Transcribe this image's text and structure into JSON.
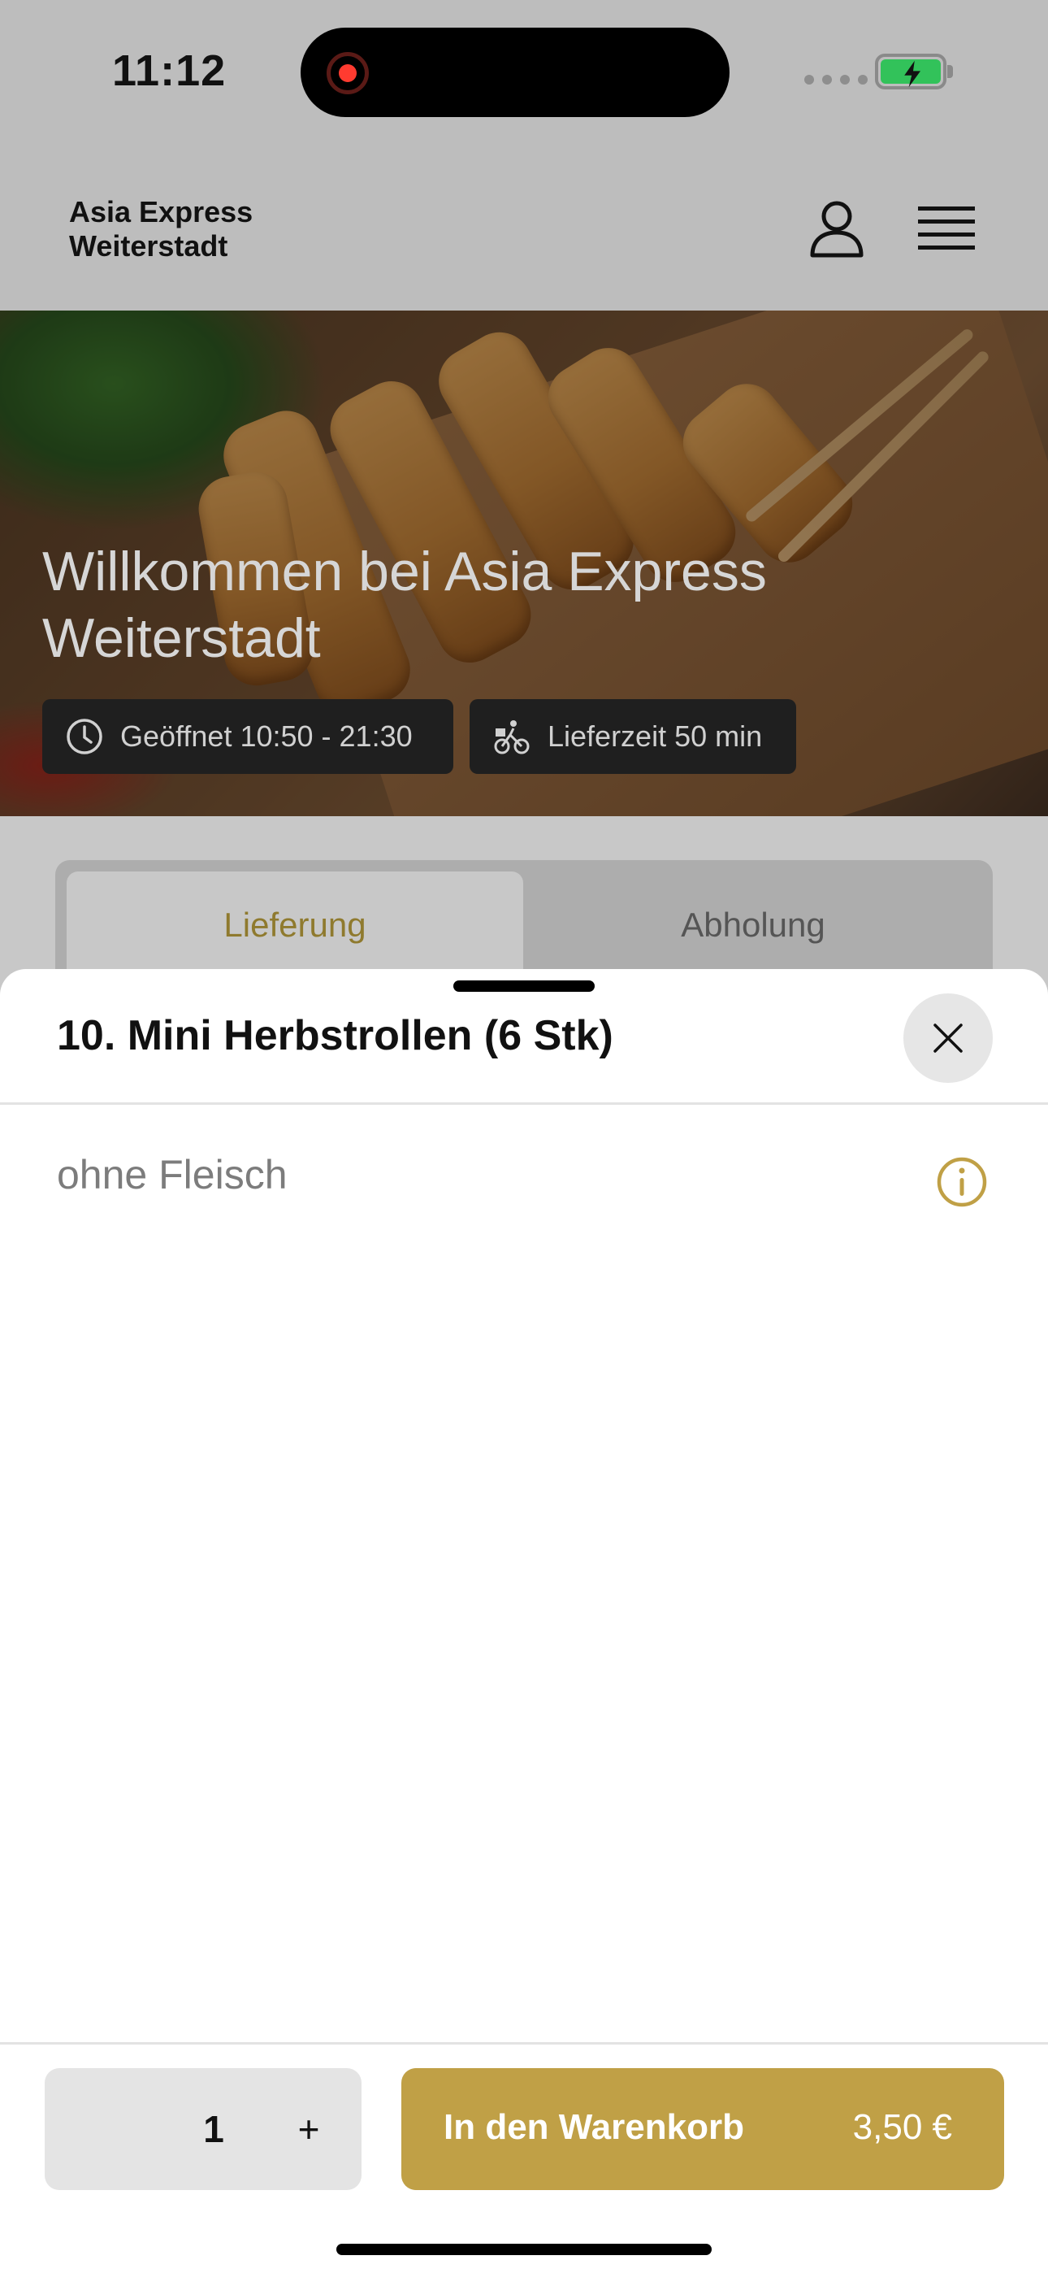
{
  "status_bar": {
    "time": "11:12"
  },
  "header": {
    "restaurant_line1": "Asia Express",
    "restaurant_line2": "Weiterstadt",
    "icons": [
      "user-icon",
      "menu-icon"
    ]
  },
  "hero": {
    "title": "Willkommen bei Asia Express Weiterstadt",
    "opening_hours": "Geöffnet 10:50 - 21:30",
    "delivery_time": "Lieferzeit 50 min"
  },
  "tabs": [
    {
      "label": "Lieferung",
      "active": true
    },
    {
      "label": "Abholung",
      "active": false
    }
  ],
  "sheet": {
    "title": "10. Mini Herbstrollen (6 Stk)",
    "option_label": "ohne Fleisch"
  },
  "footer": {
    "quantity": "1",
    "plus_label": "+",
    "cart_label": "In den Warenkorb",
    "price": "3,50 €"
  },
  "colors": {
    "accent": "#c0a046",
    "tab_active_text": "#8f7a2e",
    "battery": "#32c25a",
    "record": "#ff3b30"
  }
}
